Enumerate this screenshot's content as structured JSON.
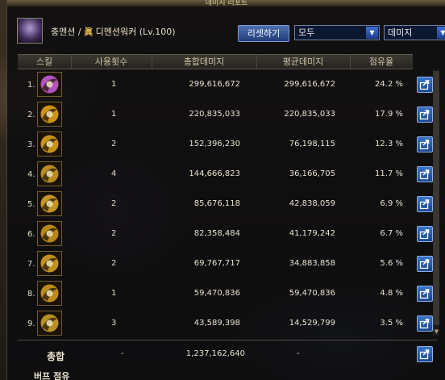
{
  "window": {
    "title": "데미지 리포트"
  },
  "character": {
    "name": "충멘션",
    "separator": "/",
    "mark": "眞",
    "job": "디멘션워커",
    "level": "(Lv.100)"
  },
  "controls": {
    "reset_label": "리셋하기",
    "filter_value": "모두",
    "sort_value": "데미지"
  },
  "table": {
    "headers": {
      "skill": "스킬",
      "uses": "사용횟수",
      "total": "총합데미지",
      "avg": "평균데미지",
      "share": "점유율"
    },
    "rows": [
      {
        "rank": "1.",
        "uses": "1",
        "total": "299,616,672",
        "avg": "299,616,672",
        "pct": "24.2 %"
      },
      {
        "rank": "2.",
        "uses": "1",
        "total": "220,835,033",
        "avg": "220,835,033",
        "pct": "17.9 %"
      },
      {
        "rank": "3.",
        "uses": "2",
        "total": "152,396,230",
        "avg": "76,198,115",
        "pct": "12.3 %"
      },
      {
        "rank": "4.",
        "uses": "4",
        "total": "144,666,823",
        "avg": "36,166,705",
        "pct": "11.7 %"
      },
      {
        "rank": "5.",
        "uses": "2",
        "total": "85,676,118",
        "avg": "42,838,059",
        "pct": "6.9 %"
      },
      {
        "rank": "6.",
        "uses": "2",
        "total": "82,358,484",
        "avg": "41,179,242",
        "pct": "6.7 %"
      },
      {
        "rank": "7.",
        "uses": "2",
        "total": "69,767,717",
        "avg": "34,883,858",
        "pct": "5.6 %"
      },
      {
        "rank": "8.",
        "uses": "1",
        "total": "59,470,836",
        "avg": "59,470,836",
        "pct": "4.8 %"
      },
      {
        "rank": "9.",
        "uses": "3",
        "total": "43,589,398",
        "avg": "14,529,799",
        "pct": "3.5 %"
      }
    ],
    "summary": {
      "label": "총합",
      "uses": "-",
      "total": "1,237,162,640",
      "avg": "-"
    }
  },
  "footer": {
    "tab_label": "버프 점유"
  },
  "colors": {
    "accent_blue": "#2a5bb0",
    "icon_gold": "#d9a21c",
    "panel": "#0c0c0e"
  }
}
